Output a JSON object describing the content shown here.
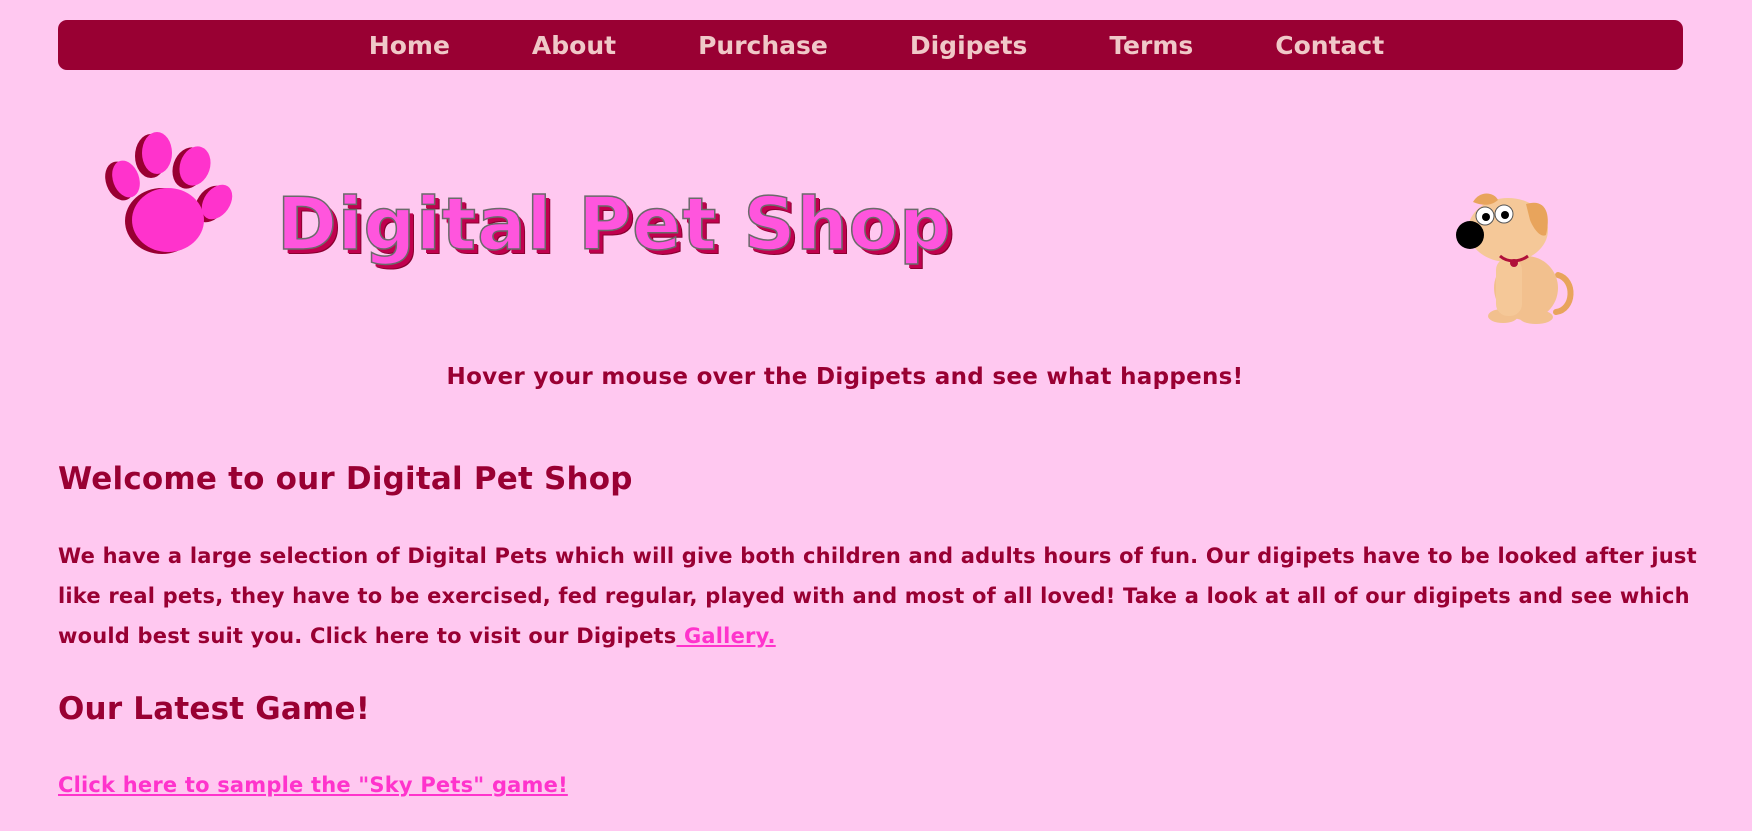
{
  "nav": {
    "items": [
      {
        "label": "Home"
      },
      {
        "label": "About"
      },
      {
        "label": "Purchase"
      },
      {
        "label": "Digipets"
      },
      {
        "label": "Terms"
      },
      {
        "label": "Contact"
      }
    ]
  },
  "banner": {
    "logo_text": "Digital Pet Shop",
    "paw_icon": "paw-icon",
    "mascot_icon": "dog-icon"
  },
  "hover_hint": "Hover your mouse over the Digipets and see what happens!",
  "welcome": {
    "title": "Welcome to our Digital Pet Shop",
    "body": "We have a large selection of Digital Pets which will give both children and adults hours of fun. Our digipets have to be looked after just like real pets, they have to be exercised, fed regular, played with and most of all loved! Take a look at all of our digipets and see which would best suit you. Click here to visit our Digipets",
    "gallery_link": " Gallery."
  },
  "game": {
    "title": "Our Latest Game!",
    "link": "Click here to sample the \"Sky Pets\" game!"
  },
  "colors": {
    "background": "#ffc8f0",
    "nav_bar": "#990033",
    "nav_text": "#f0c8c8",
    "text": "#990033",
    "link": "#ff33cc"
  }
}
